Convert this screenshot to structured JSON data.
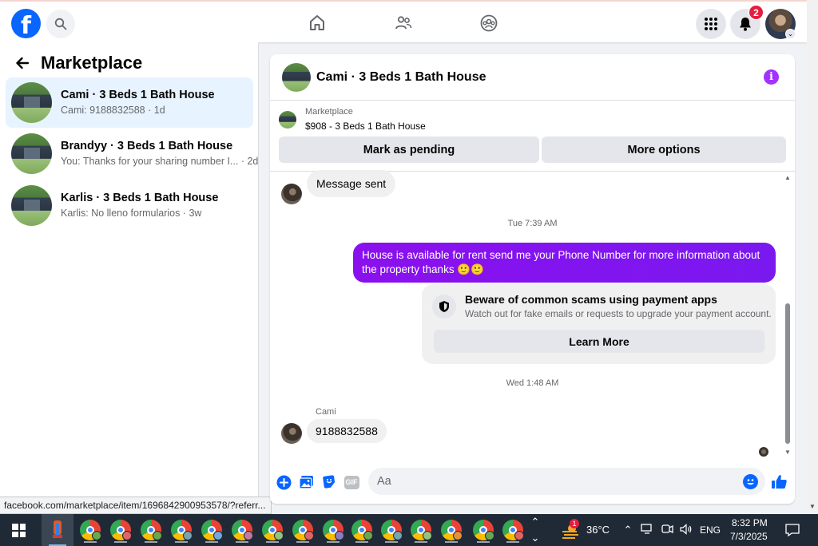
{
  "topbar": {
    "logo_letter": "f",
    "notification_count": "2"
  },
  "sidebar": {
    "title": "Marketplace",
    "conversations": [
      {
        "name": "Cami · 3 Beds 1 Bath House",
        "preview": "Cami: 9188832588 · 1d",
        "active": true
      },
      {
        "name": "Brandyy · 3 Beds 1 Bath House",
        "preview": "You: Thanks for your sharing number I... · 2d",
        "active": false
      },
      {
        "name": "Karlis · 3 Beds 1 Bath House",
        "preview": "Karlis: No lleno formularios · 3w",
        "active": false
      }
    ]
  },
  "status_url": "facebook.com/marketplace/item/1696842900953578/?referr...",
  "chat": {
    "title": "Cami · 3 Beds 1 Bath House",
    "listing": {
      "label": "Marketplace",
      "description": "$908 - 3 Beds 1 Bath House",
      "mark_pending": "Mark as pending",
      "more_options": "More options"
    },
    "messages": {
      "sent_notice": "Message sent",
      "timestamp_1": "Tue 7:39 AM",
      "outgoing": "House is available for rent send me your Phone Number for more information about the property thanks 🙂🙂",
      "scam_title": "Beware of common scams using payment apps",
      "scam_sub": "Watch out for fake emails or requests to upgrade your payment account.",
      "learn_more": "Learn More",
      "timestamp_2": "Wed 1:48 AM",
      "sender": "Cami",
      "incoming": "9188832588"
    },
    "composer": {
      "placeholder": "Aa",
      "gif_label": "GIF"
    }
  },
  "taskbar": {
    "temperature": "36°C",
    "language": "ENG",
    "time": "8:32 PM",
    "date": "7/3/2025",
    "weather_badge": "1"
  },
  "colors": {
    "facebook_blue": "#0866ff",
    "outgoing_bubble": "#8a0df0",
    "active_conversation": "#e7f3ff",
    "notification_red": "#e41e3f"
  }
}
